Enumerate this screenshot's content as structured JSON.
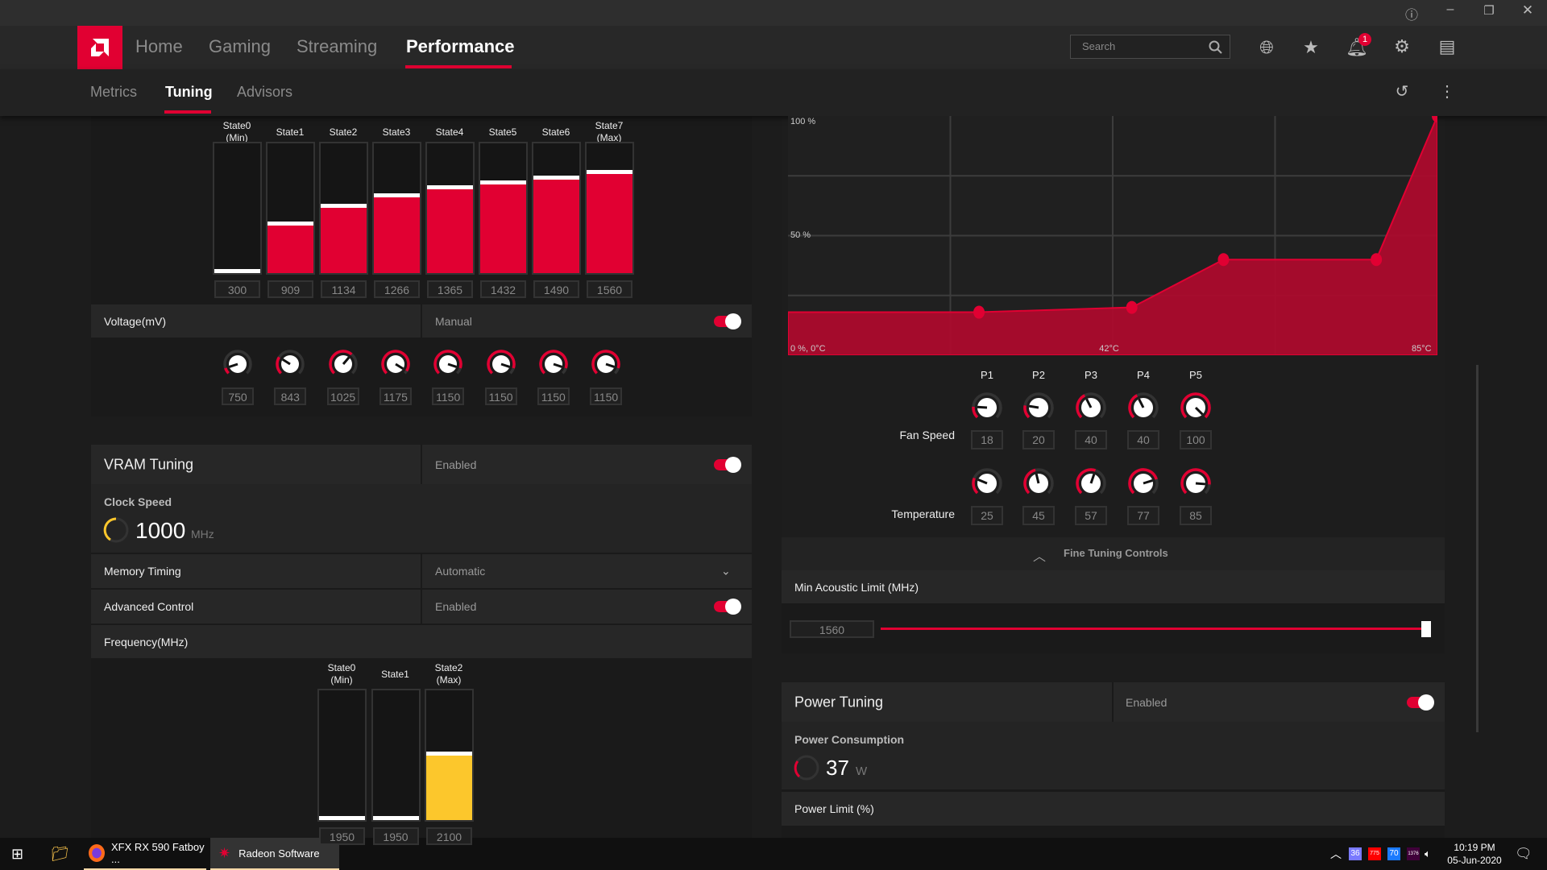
{
  "window": {
    "controls": [
      "help-icon",
      "minimize-icon",
      "restore-icon",
      "close-icon"
    ]
  },
  "nav": {
    "tabs": [
      {
        "label": "Home"
      },
      {
        "label": "Gaming"
      },
      {
        "label": "Streaming"
      },
      {
        "label": "Performance",
        "active": true
      }
    ],
    "search_placeholder": "Search",
    "notification_count": "1",
    "icons": [
      "globe-icon",
      "star-icon",
      "bell-icon",
      "gear-icon",
      "panel-icon"
    ]
  },
  "subnav": {
    "tabs": [
      {
        "label": "Metrics"
      },
      {
        "label": "Tuning",
        "active": true
      },
      {
        "label": "Advisors"
      }
    ]
  },
  "gpu": {
    "states": [
      {
        "l1": "State0",
        "l2": "(Min)",
        "freq": "300"
      },
      {
        "l1": "State1",
        "freq": "909"
      },
      {
        "l1": "State2",
        "freq": "1134"
      },
      {
        "l1": "State3",
        "freq": "1266"
      },
      {
        "l1": "State4",
        "freq": "1365"
      },
      {
        "l1": "State5",
        "freq": "1432"
      },
      {
        "l1": "State6",
        "freq": "1490"
      },
      {
        "l1": "State7",
        "l2": "(Max)",
        "freq": "1560"
      }
    ],
    "voltage_label": "Voltage(mV)",
    "voltage_mode": "Manual",
    "voltage_toggle": true,
    "voltages": [
      "750",
      "843",
      "1025",
      "1175",
      "1150",
      "1150",
      "1150",
      "1150"
    ]
  },
  "vram": {
    "title": "VRAM Tuning",
    "status": "Enabled",
    "toggle": true,
    "clock_label": "Clock Speed",
    "clock_value": "1000",
    "clock_unit": "MHz",
    "memory_timing_label": "Memory Timing",
    "memory_timing_value": "Automatic",
    "advanced_label": "Advanced Control",
    "advanced_value": "Enabled",
    "frequency_label": "Frequency(MHz)",
    "states": [
      {
        "l1": "State0",
        "l2": "(Min)",
        "freq": "1950"
      },
      {
        "l1": "State1",
        "freq": "1950"
      },
      {
        "l1": "State2",
        "l2": "(Max)",
        "freq": "2100"
      }
    ]
  },
  "fan": {
    "chart_data": {
      "type": "area",
      "x_unit": "°C",
      "y_unit": "%",
      "xlim": [
        0,
        85
      ],
      "ylim": [
        0,
        100
      ],
      "grid": true,
      "y_ticks": [
        "100 %",
        "50 %"
      ],
      "x_ticks": [
        "0 %, 0°C",
        "42°C",
        "85°C"
      ],
      "points": [
        {
          "temp": 25,
          "speed": 18
        },
        {
          "temp": 45,
          "speed": 20
        },
        {
          "temp": 57,
          "speed": 40
        },
        {
          "temp": 77,
          "speed": 40
        },
        {
          "temp": 85,
          "speed": 100
        }
      ],
      "color": "#b00a2e"
    },
    "point_labels": [
      "P1",
      "P2",
      "P3",
      "P4",
      "P5"
    ],
    "fan_speed_label": "Fan Speed",
    "fan_speeds": [
      "18",
      "20",
      "40",
      "40",
      "100"
    ],
    "temperature_label": "Temperature",
    "temperatures": [
      "25",
      "45",
      "57",
      "77",
      "85"
    ],
    "fine_tuning_label": "Fine Tuning Controls",
    "min_acoustic_label": "Min Acoustic Limit (MHz)",
    "min_acoustic_value": "1560"
  },
  "power": {
    "title": "Power Tuning",
    "status": "Enabled",
    "toggle": true,
    "consumption_label": "Power Consumption",
    "consumption_value": "37",
    "consumption_unit": "W",
    "limit_label": "Power Limit (%)"
  },
  "taskbar": {
    "apps": [
      {
        "label": "XFX RX 590 Fatboy ..."
      },
      {
        "label": "Radeon Software"
      }
    ],
    "tray": [
      "36",
      "775",
      "70",
      "1376"
    ],
    "time": "10:19 PM",
    "date": "05-Jun-2020"
  },
  "colors": {
    "accent": "#e10032",
    "vram_fill": "#fcc72c"
  }
}
